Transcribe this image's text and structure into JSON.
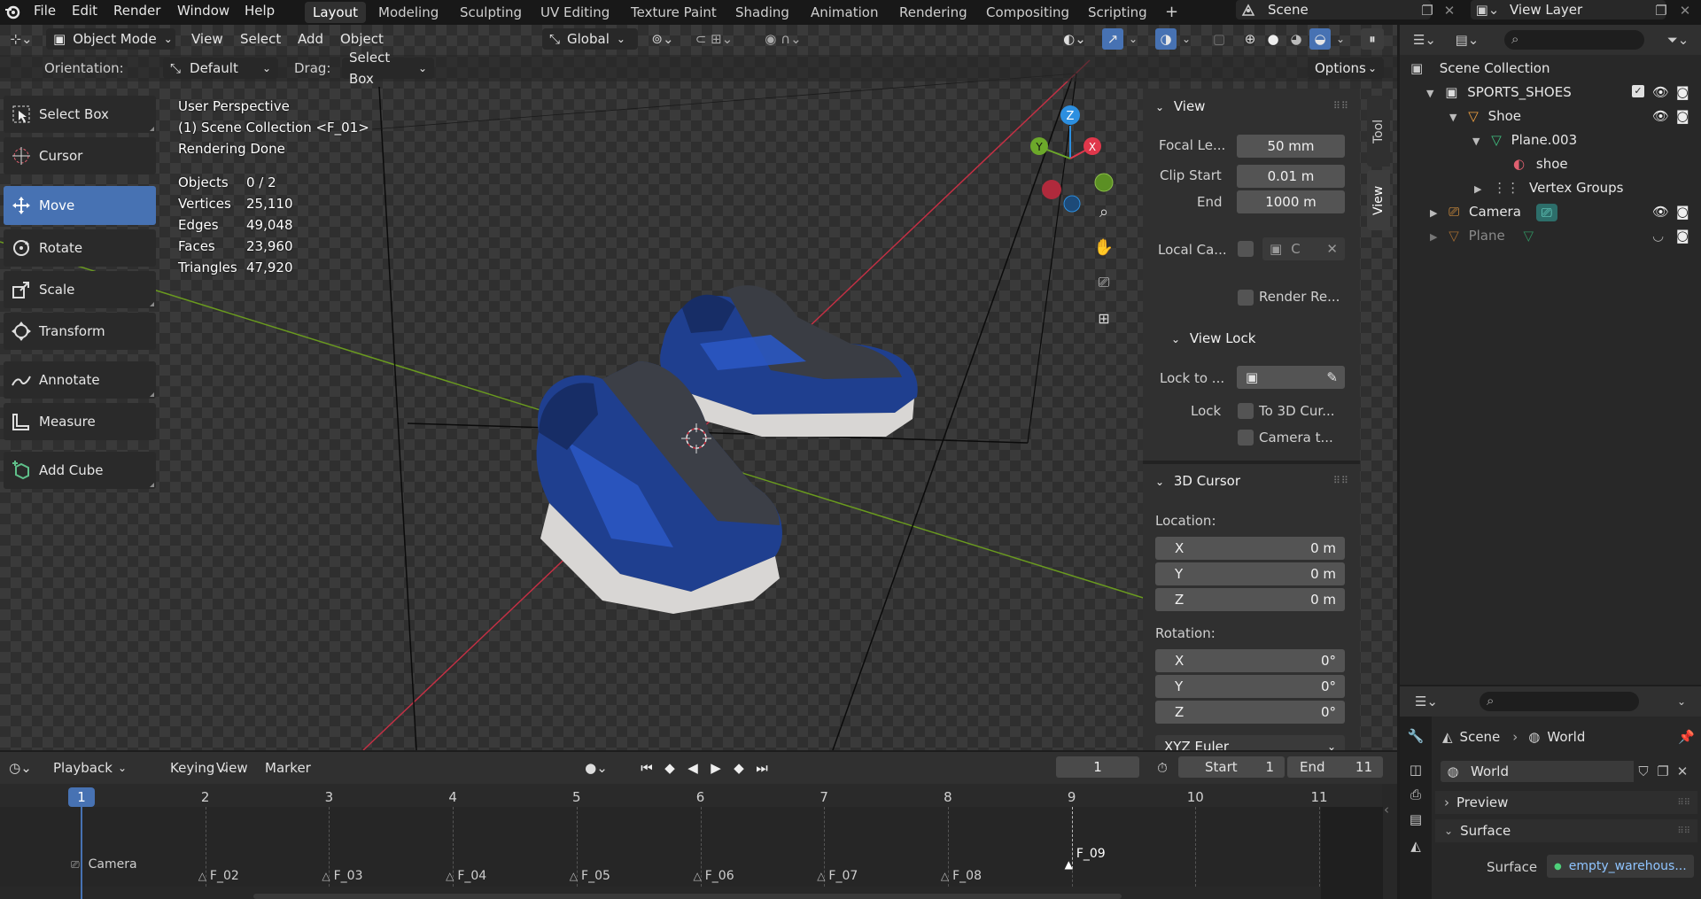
{
  "topbar": {
    "menus": [
      "File",
      "Edit",
      "Render",
      "Window",
      "Help"
    ],
    "workspaces": [
      "Layout",
      "Modeling",
      "Sculpting",
      "UV Editing",
      "Texture Paint",
      "Shading",
      "Animation",
      "Rendering",
      "Compositing",
      "Scripting"
    ],
    "active_workspace": "Layout",
    "add_tab": "+",
    "scene": "Scene",
    "view_layer": "View Layer"
  },
  "viewport_header": {
    "mode": "Object Mode",
    "menus": [
      "View",
      "Select",
      "Add",
      "Object"
    ],
    "transform_orientation": "Global"
  },
  "tool_settings": {
    "orientation_label": "Orientation:",
    "orientation_value": "Default",
    "drag_label": "Drag:",
    "drag_value": "Select Box",
    "options": "Options"
  },
  "toolbar": [
    {
      "label": "Select Box",
      "icon": "select-box-icon",
      "active": false
    },
    {
      "label": "Cursor",
      "icon": "cursor-icon",
      "active": false
    },
    {
      "label": "Move",
      "icon": "move-icon",
      "active": true
    },
    {
      "label": "Rotate",
      "icon": "rotate-icon",
      "active": false
    },
    {
      "label": "Scale",
      "icon": "scale-icon",
      "active": false
    },
    {
      "label": "Transform",
      "icon": "transform-icon",
      "active": false
    },
    {
      "label": "Annotate",
      "icon": "annotate-icon",
      "active": false
    },
    {
      "label": "Measure",
      "icon": "measure-icon",
      "active": false
    },
    {
      "label": "Add Cube",
      "icon": "add-cube-icon",
      "active": false
    }
  ],
  "overlay": {
    "line1": "User Perspective",
    "line2": "(1) Scene Collection <F_01>",
    "line3": "Rendering Done",
    "stats": [
      {
        "label": "Objects",
        "value": "0 / 2"
      },
      {
        "label": "Vertices",
        "value": "25,110"
      },
      {
        "label": "Edges",
        "value": "49,048"
      },
      {
        "label": "Faces",
        "value": "23,960"
      },
      {
        "label": "Triangles",
        "value": "47,920"
      }
    ]
  },
  "gizmo": {
    "z": "Z",
    "y": "Y",
    "x": "X",
    "x_color": "#e0374b",
    "y_color": "#6ca82a",
    "z_color": "#2c8fe0"
  },
  "side_tabs": {
    "tool": "Tool",
    "view": "View"
  },
  "npanel": {
    "view_title": "View",
    "focal_label": "Focal Le...",
    "focal_value": "50 mm",
    "clip_start_label": "Clip Start",
    "clip_start_value": "0.01 m",
    "end_label": "End",
    "end_value": "1000 m",
    "local_camera_label": "Local Ca...",
    "local_camera_value": "C",
    "render_region_label": "Render Re...",
    "view_lock_title": "View Lock",
    "lock_to_label": "Lock to ...",
    "lock_label": "Lock",
    "lock_3d_cursor": "To 3D Cur...",
    "lock_camera": "Camera t...",
    "cursor_title": "3D Cursor",
    "location_label": "Location:",
    "loc_x_label": "X",
    "loc_x": "0 m",
    "loc_y_label": "Y",
    "loc_y": "0 m",
    "loc_z_label": "Z",
    "loc_z": "0 m",
    "rotation_label": "Rotation:",
    "rot_x_label": "X",
    "rot_x": "0°",
    "rot_y_label": "Y",
    "rot_y": "0°",
    "rot_z_label": "Z",
    "rot_z": "0°",
    "rotation_mode": "XYZ Euler"
  },
  "outliner": {
    "root": "Scene Collection",
    "items": [
      {
        "label": "SPORTS_SHOES",
        "icon": "collection-icon"
      },
      {
        "label": "Shoe",
        "icon": "mesh-object-icon"
      },
      {
        "label": "Plane.003",
        "icon": "mesh-data-icon"
      },
      {
        "label": "shoe",
        "icon": "material-icon"
      },
      {
        "label": "Vertex Groups",
        "icon": "vertex-groups-icon"
      },
      {
        "label": "Camera",
        "icon": "camera-object-icon"
      },
      {
        "label": "Plane",
        "icon": "mesh-object-icon"
      }
    ]
  },
  "properties": {
    "breadcrumb_scene": "Scene",
    "breadcrumb_world": "World",
    "world_name": "World",
    "preview": "Preview",
    "surface_section": "Surface",
    "surface_label": "Surface",
    "surface_value": "empty_warehous..."
  },
  "timeline": {
    "menus": [
      "Playback",
      "Keying",
      "View",
      "Marker"
    ],
    "current_frame": "1",
    "start_label": "Start",
    "start": "1",
    "end_label": "End",
    "end": "11",
    "frames": [
      "1",
      "2",
      "3",
      "4",
      "5",
      "6",
      "7",
      "8",
      "9",
      "10",
      "11"
    ],
    "markers": [
      {
        "label": "Camera"
      },
      {
        "label": "F_02"
      },
      {
        "label": "F_03"
      },
      {
        "label": "F_04"
      },
      {
        "label": "F_05"
      },
      {
        "label": "F_06"
      },
      {
        "label": "F_07"
      },
      {
        "label": "F_08"
      },
      {
        "label": "F_09"
      }
    ]
  }
}
